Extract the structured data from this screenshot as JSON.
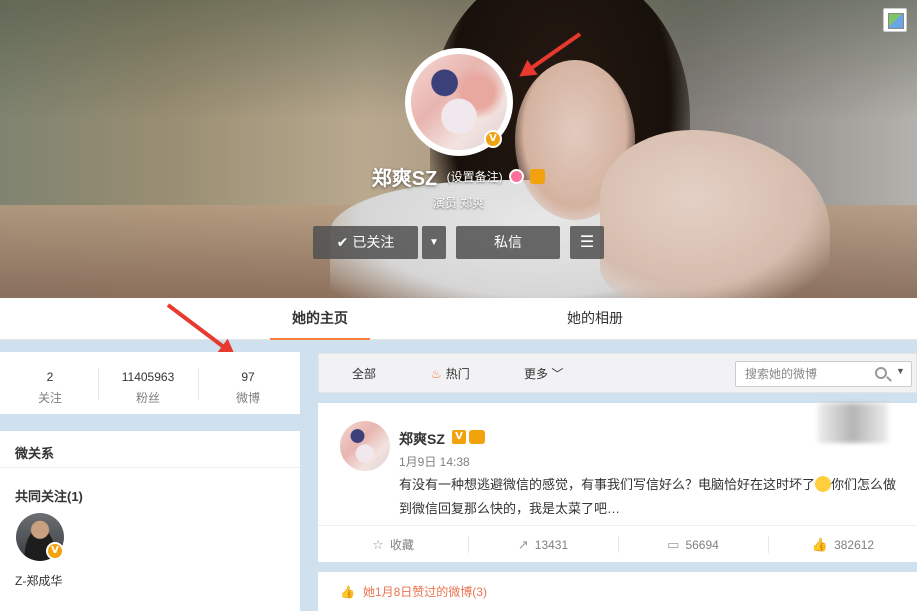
{
  "profile": {
    "name": "郑爽SZ",
    "remark_link": "(设置备注)",
    "subtitle": "演员 郑爽",
    "verified_mark": "V"
  },
  "actions": {
    "follow_label": "已关注",
    "follow_check": "✔",
    "dropdown_icon": "▼",
    "message_label": "私信",
    "more_icon": "☰"
  },
  "tabs": [
    {
      "label": "她的主页",
      "active": true
    },
    {
      "label": "她的相册",
      "active": false
    }
  ],
  "stats": [
    {
      "value": "2",
      "label": "关注"
    },
    {
      "value": "11405963",
      "label": "粉丝"
    },
    {
      "value": "97",
      "label": "微博"
    }
  ],
  "relations": {
    "title": "微关系",
    "common_follow_title": "共同关注(1)",
    "friends": [
      {
        "name": "Z-郑成华",
        "verified_mark": "V"
      }
    ]
  },
  "filter": {
    "all_label": "全部",
    "hot_label": "热门",
    "more_label": "更多",
    "search_placeholder": "搜索她的微博"
  },
  "post": {
    "author": "郑爽SZ",
    "time": "1月9日 14:38",
    "text_before_emoji": "有没有一种想逃避微信的感觉，有事我们写信好么？电脑恰好在这时坏了",
    "text_after_emoji": "你们怎么做到微信回复那么快的，我是太菜了吧…",
    "favorite_label": "收藏",
    "repost_count": "13431",
    "comment_count": "56694",
    "like_count": "382612"
  },
  "liked_section": {
    "text": "她1月8日赞过的微博(3)"
  },
  "colors": {
    "accent_orange": "#fa7d3c",
    "verified_gold": "#f2a20c",
    "arrow_red": "#e8392f",
    "liked_text": "#eb7350"
  }
}
